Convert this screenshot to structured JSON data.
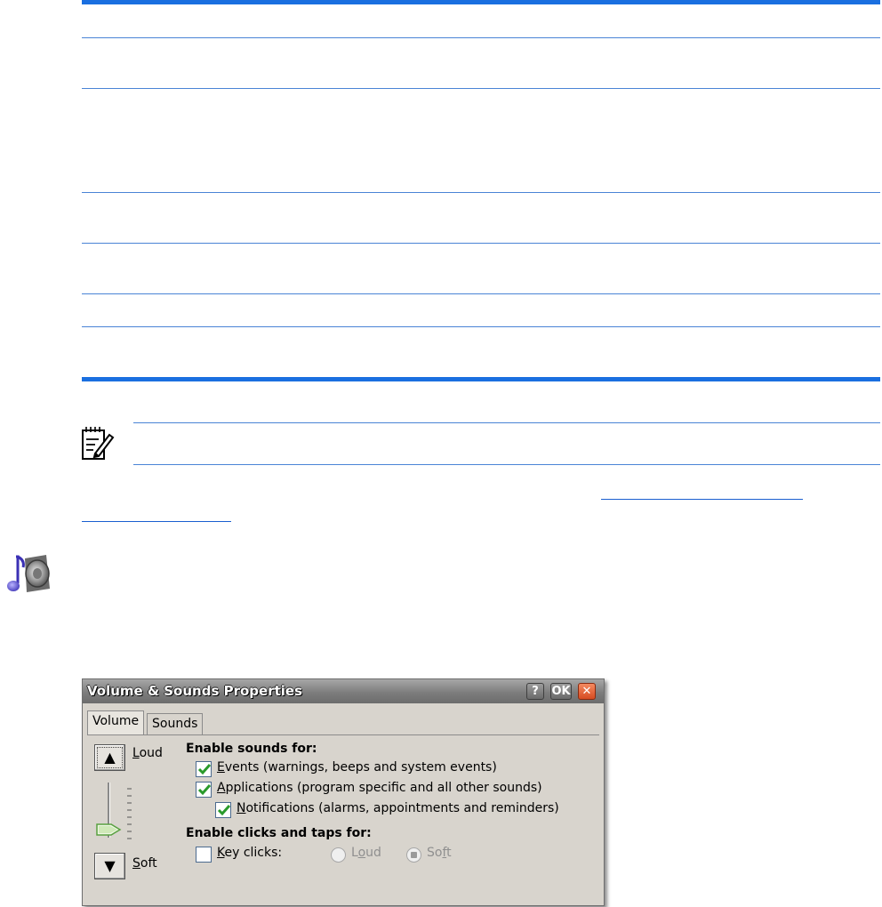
{
  "dialog": {
    "title": "Volume & Sounds Properties",
    "help_label": "?",
    "ok_label": "OK",
    "close_label": "✕",
    "tabs": [
      {
        "label": "Volume",
        "active": true
      },
      {
        "label": "Sounds",
        "active": false
      }
    ],
    "volume": {
      "up_arrow": "▲",
      "down_arrow": "▼",
      "loud_label_u": "L",
      "loud_label_rest": "oud",
      "soft_label_u": "S",
      "soft_label_rest": "oft",
      "level": 0.05
    },
    "enable_sounds": {
      "heading": "Enable sounds for:",
      "options": [
        {
          "u": "E",
          "rest": "vents (warnings, beeps and system events)",
          "checked": true
        },
        {
          "u": "A",
          "rest": "pplications (program specific and all other sounds)",
          "checked": true
        },
        {
          "u": "N",
          "rest": "otifications (alarms, appointments and reminders)",
          "checked": true
        }
      ]
    },
    "enable_clicks": {
      "heading": "Enable clicks and taps for:",
      "keyclicks_u": "K",
      "keyclicks_rest": "ey clicks:",
      "keyclicks_checked": false,
      "radio_loud_pre": "L",
      "radio_loud_u": "o",
      "radio_loud_rest": "ud",
      "radio_soft_pre": "So",
      "radio_soft_u": "f",
      "radio_soft_rest": "t",
      "selected": "Soft"
    }
  },
  "colors": {
    "rule": "#1a6fe0",
    "dialog_bg": "#d8d4cd",
    "check": "#2a9a2a",
    "close_button": "#e2572e"
  },
  "icons": [
    "note-icon",
    "sound-speaker-icon",
    "help-icon",
    "close-icon",
    "checkmark-icon"
  ]
}
